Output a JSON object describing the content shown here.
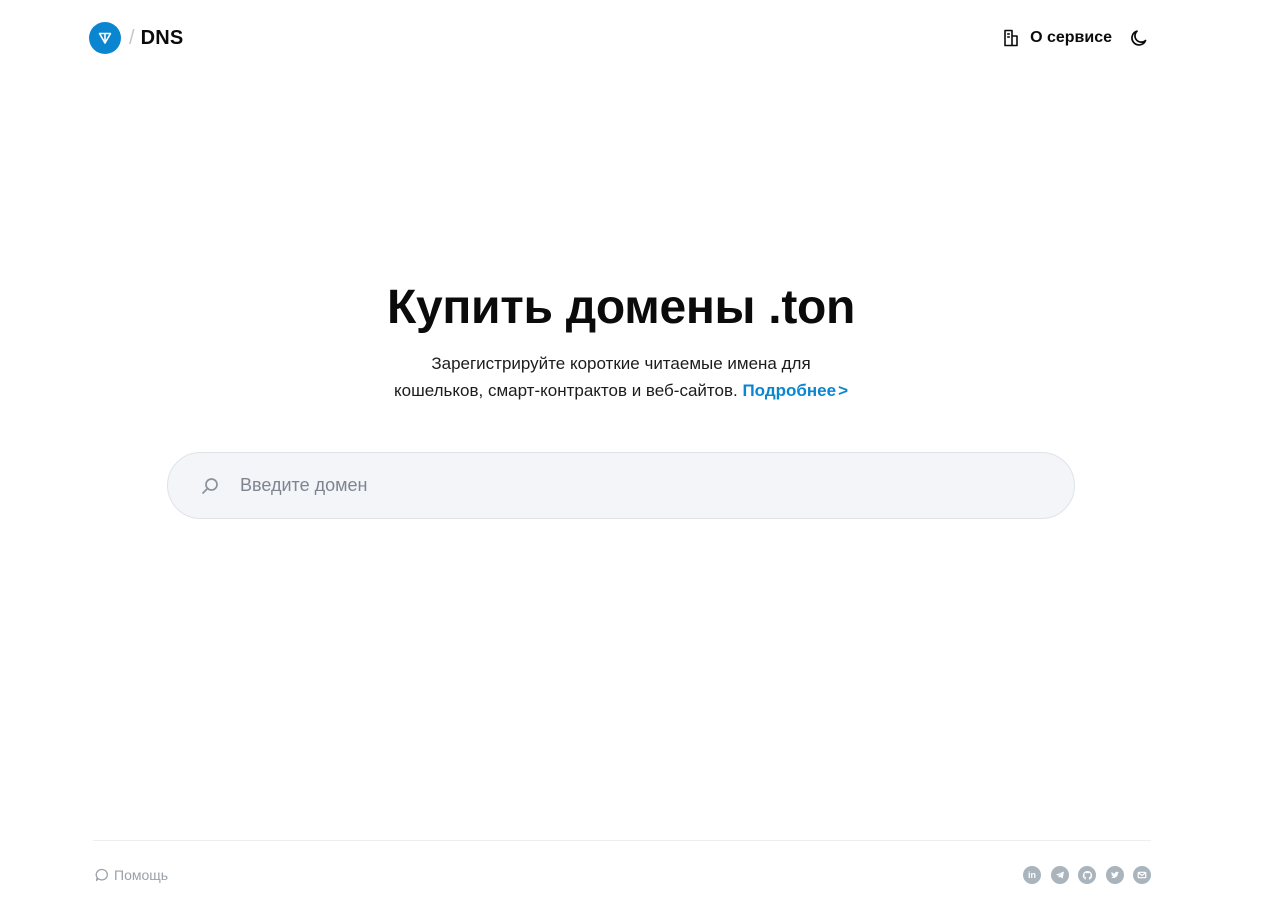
{
  "header": {
    "brand_separator": "/",
    "brand_name": "DNS",
    "about_label": "О сервисе"
  },
  "hero": {
    "title": "Купить домены .ton",
    "subtitle_line1": "Зарегистрируйте короткие читаемые имена для",
    "subtitle_line2": "кошельков, смарт-контрактов и веб-сайтов.",
    "more_link": "Подробнее",
    "more_chevron": ">"
  },
  "search": {
    "placeholder": "Введите домен",
    "value": ""
  },
  "footer": {
    "help_label": "Помощь",
    "socials": [
      {
        "name": "linkedin",
        "glyph": "in"
      },
      {
        "name": "telegram",
        "glyph": ""
      },
      {
        "name": "github",
        "glyph": ""
      },
      {
        "name": "twitter",
        "glyph": ""
      },
      {
        "name": "email",
        "glyph": ""
      }
    ]
  },
  "colors": {
    "accent": "#0a86d0",
    "text": "#0b0b0c",
    "muted": "#9aa1a9",
    "search_bg": "#f3f5f8",
    "social_bg": "#a9b4bd"
  }
}
